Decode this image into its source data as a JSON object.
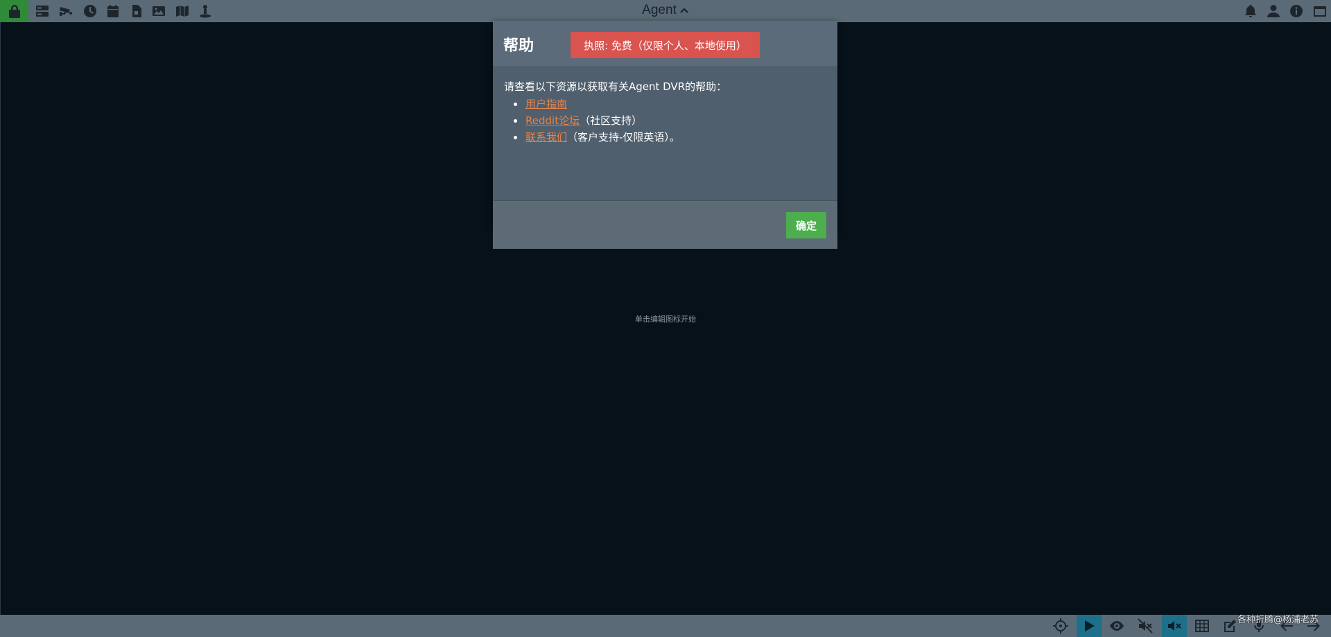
{
  "app": {
    "title": "Agent"
  },
  "toolbar_top": {
    "left_icons": [
      "lock-icon",
      "server-icon",
      "camera-icon",
      "clock-icon",
      "calendar-icon",
      "file-icon",
      "image-icon",
      "map-icon",
      "user-location-icon"
    ],
    "right_icons": [
      "bell-icon",
      "user-icon",
      "info-icon",
      "window-icon"
    ]
  },
  "dialog": {
    "title": "帮助",
    "license_badge": "执照: 免费（仅限个人、本地使用）",
    "intro": "请查看以下资源以获取有关Agent DVR的帮助：",
    "resources": [
      {
        "link": "用户指南",
        "note": ""
      },
      {
        "link": "Reddit论坛",
        "note": "（社区支持）"
      },
      {
        "link": "联系我们",
        "note": "（客户支持-仅限英语）。"
      }
    ],
    "ok_label": "确定"
  },
  "main": {
    "hint": "单击编辑图标开始"
  },
  "toolbar_bottom": {
    "icons": [
      "crosshair-icon",
      "play-icon",
      "eye-icon",
      "mute-icon",
      "mute-active-icon",
      "grid-icon",
      "edit-icon",
      "microphone-icon",
      "arrow-left-icon",
      "arrow-right-icon"
    ]
  },
  "watermark": "各种折腾@杨浦老苏",
  "colors": {
    "license_badge": "#d9534f",
    "ok_button": "#4cae4c",
    "link": "#e8834a",
    "lock_active": "#2f8a3a"
  }
}
